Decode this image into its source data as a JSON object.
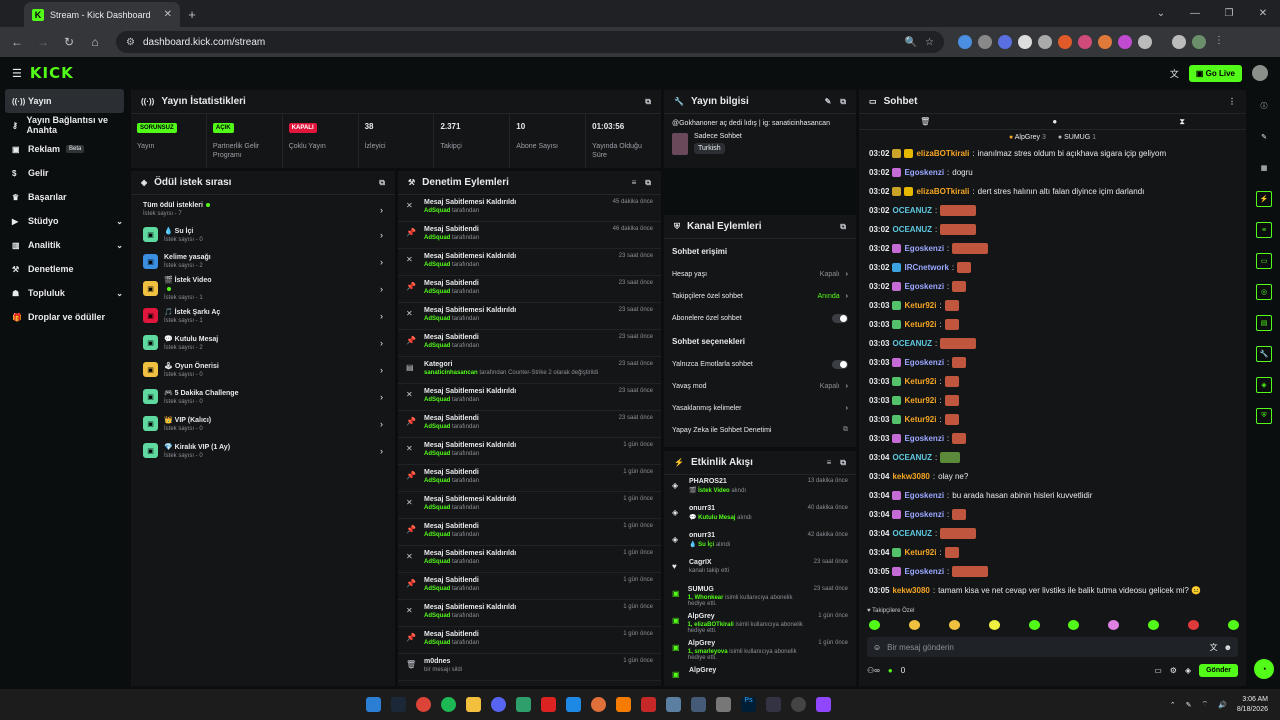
{
  "browser": {
    "tab_title": "Stream - Kick Dashboard",
    "url": "dashboard.kick.com/stream"
  },
  "header": {
    "logo": "KICK",
    "go_live": "Go Live"
  },
  "sidebar": {
    "items": [
      {
        "label": "Yayın",
        "icon": "broadcast-icon"
      },
      {
        "label": "Yayın Bağlantısı ve Anahta",
        "icon": "key-icon"
      },
      {
        "label": "Reklam",
        "icon": "ad-icon",
        "badge": "Beta"
      },
      {
        "label": "Gelir",
        "icon": "money-icon"
      },
      {
        "label": "Başarılar",
        "icon": "trophy-icon"
      },
      {
        "label": "Stüdyo",
        "icon": "studio-icon"
      },
      {
        "label": "Analitik",
        "icon": "chart-icon"
      },
      {
        "label": "Denetleme",
        "icon": "hammer-icon"
      },
      {
        "label": "Topluluk",
        "icon": "community-icon"
      },
      {
        "label": "Droplar ve ödüller",
        "icon": "gift-icon"
      }
    ]
  },
  "stats": {
    "title": "Yayın İstatistikleri",
    "items": [
      {
        "badge": "SORUNSUZ",
        "value": "",
        "label": "Yayın",
        "color": "#53fc18"
      },
      {
        "badge": "AÇIK",
        "value": "",
        "label": "Partnerlik Gelir Programı",
        "color": "#53fc18"
      },
      {
        "badge": "KAPALI",
        "value": "",
        "label": "Çoklu Yayın",
        "color": "#e0163c"
      },
      {
        "badge": "",
        "value": "38",
        "label": "İzleyici"
      },
      {
        "badge": "",
        "value": "2.371",
        "label": "Takipçi"
      },
      {
        "badge": "",
        "value": "10",
        "label": "Abone Sayısı"
      },
      {
        "badge": "",
        "value": "01:03:56",
        "label": "Yayında Olduğu Süre"
      }
    ]
  },
  "info": {
    "title": "Yayın bilgisi",
    "stream_title": "@Gokhanoner aç dedi lıdış | ig: sanaticinhasancan",
    "category": "Sadece Sohbet",
    "tag": "Turkish"
  },
  "queue": {
    "title": "Ödül istek sırası",
    "all_label": "Tüm ödül istekleri",
    "all_count": "İstek sayısı - 7",
    "items": [
      {
        "name": "💧 Su İçi",
        "count": "İstek sayısı - 0"
      },
      {
        "name": "Kelime yasağı",
        "count": "İstek sayısı - 2"
      },
      {
        "name": "🎬 İstek Video",
        "count": "İstek sayısı - 1"
      },
      {
        "name": "🎵 İstek Şarkı Aç",
        "count": "İstek sayısı - 1"
      },
      {
        "name": "💬 Kutulu Mesaj",
        "count": "İstek sayısı - 2"
      },
      {
        "name": "🕹 Oyun Önerisi",
        "count": "İstek sayısı - 0"
      },
      {
        "name": "🎮 5 Dakika Challenge",
        "count": "İstek sayısı - 0"
      },
      {
        "name": "👑 VIP (Kalıcı)",
        "count": "İstek sayısı - 0"
      },
      {
        "name": "💎 Kiralık VIP (1 Ay)",
        "count": "İstek sayısı - 0"
      }
    ]
  },
  "moderation": {
    "title": "Denetim Eylemleri",
    "items": [
      {
        "icon": "unpin-icon",
        "title": "Mesaj Sabitlemesi Kaldırıldı",
        "user": "AdSquad",
        "suffix": "tarafından",
        "time": "45 dakika önce"
      },
      {
        "icon": "pin-icon",
        "title": "Mesaj Sabitlendi",
        "user": "AdSquad",
        "suffix": "tarafından",
        "time": "46 dakika önce"
      },
      {
        "icon": "unpin-icon",
        "title": "Mesaj Sabitlemesi Kaldırıldı",
        "user": "AdSquad",
        "suffix": "tarafından",
        "time": "23 saat önce"
      },
      {
        "icon": "pin-icon",
        "title": "Mesaj Sabitlendi",
        "user": "AdSquad",
        "suffix": "tarafından",
        "time": "23 saat önce"
      },
      {
        "icon": "unpin-icon",
        "title": "Mesaj Sabitlemesi Kaldırıldı",
        "user": "AdSquad",
        "suffix": "tarafından",
        "time": "23 saat önce"
      },
      {
        "icon": "pin-icon",
        "title": "Mesaj Sabitlendi",
        "user": "AdSquad",
        "suffix": "tarafından",
        "time": "23 saat önce"
      },
      {
        "icon": "category-icon",
        "title": "Kategori",
        "user": "sanaticinhasancan",
        "suffix": "tarafından Counter-Strike 2 olarak değiştirildi",
        "time": "23 saat önce"
      },
      {
        "icon": "unpin-icon",
        "title": "Mesaj Sabitlemesi Kaldırıldı",
        "user": "AdSquad",
        "suffix": "tarafından",
        "time": "23 saat önce"
      },
      {
        "icon": "pin-icon",
        "title": "Mesaj Sabitlendi",
        "user": "AdSquad",
        "suffix": "tarafından",
        "time": "23 saat önce"
      },
      {
        "icon": "unpin-icon",
        "title": "Mesaj Sabitlemesi Kaldırıldı",
        "user": "AdSquad",
        "suffix": "tarafından",
        "time": "1 gün önce"
      },
      {
        "icon": "pin-icon",
        "title": "Mesaj Sabitlendi",
        "user": "AdSquad",
        "suffix": "tarafından",
        "time": "1 gün önce"
      },
      {
        "icon": "unpin-icon",
        "title": "Mesaj Sabitlemesi Kaldırıldı",
        "user": "AdSquad",
        "suffix": "tarafından",
        "time": "1 gün önce"
      },
      {
        "icon": "pin-icon",
        "title": "Mesaj Sabitlendi",
        "user": "AdSquad",
        "suffix": "tarafından",
        "time": "1 gün önce"
      },
      {
        "icon": "unpin-icon",
        "title": "Mesaj Sabitlemesi Kaldırıldı",
        "user": "AdSquad",
        "suffix": "tarafından",
        "time": "1 gün önce"
      },
      {
        "icon": "pin-icon",
        "title": "Mesaj Sabitlendi",
        "user": "AdSquad",
        "suffix": "tarafından",
        "time": "1 gün önce"
      },
      {
        "icon": "unpin-icon",
        "title": "Mesaj Sabitlemesi Kaldırıldı",
        "user": "AdSquad",
        "suffix": "tarafından",
        "time": "1 gün önce"
      },
      {
        "icon": "pin-icon",
        "title": "Mesaj Sabitlendi",
        "user": "AdSquad",
        "suffix": "tarafından",
        "time": "1 gün önce"
      },
      {
        "icon": "trash-icon",
        "title": "m0dnes",
        "user": "",
        "suffix": "bir mesajı sildi",
        "time": "1 gün önce"
      }
    ]
  },
  "channel_actions": {
    "title": "Kanal Eylemleri",
    "section1": "Sohbet erişimi",
    "rows1": [
      {
        "label": "Hesap yaşı",
        "value": "Kapalı",
        "kind": "chevron"
      },
      {
        "label": "Takipçilere özel sohbet",
        "value": "Anında",
        "kind": "chevron-green"
      },
      {
        "label": "Abonelere özel sohbet",
        "value": "",
        "kind": "toggle"
      }
    ],
    "section2": "Sohbet seçenekleri",
    "rows2": [
      {
        "label": "Yalnızca Emotlarla sohbet",
        "value": "",
        "kind": "toggle"
      },
      {
        "label": "Yavaş mod",
        "value": "Kapalı",
        "kind": "chevron"
      },
      {
        "label": "Yasaklanmış kelimeler",
        "value": "",
        "kind": "chevron"
      },
      {
        "label": "Yapay Zeka ile Sohbet Denetimi",
        "value": "",
        "kind": "external"
      }
    ]
  },
  "activity": {
    "title": "Etkinlik Akışı",
    "items": [
      {
        "icon": "reward-icon",
        "user": "PHAROS21",
        "detail": "🎬 İstek Video",
        "suffix": "alındı",
        "time": "13 dakika önce"
      },
      {
        "icon": "reward-icon",
        "user": "onurr31",
        "detail": "💬 Kutulu Mesaj",
        "suffix": "alındı",
        "time": "40 dakika önce"
      },
      {
        "icon": "reward-icon",
        "user": "onurr31",
        "detail": "💧 Su İçi",
        "suffix": "alındı",
        "time": "42 dakika önce"
      },
      {
        "icon": "heart-icon",
        "user": "CagrIX",
        "detail": "",
        "suffix": "kanalı takip etti",
        "time": "23 saat önce"
      },
      {
        "icon": "gift-sub-icon",
        "user": "SUMUG",
        "detail": "1, Whonkear",
        "suffix": "isimli kullanıcıya abonelik hediye etti.",
        "time": "23 saat önce"
      },
      {
        "icon": "gift-sub-icon",
        "user": "AlpGrey",
        "detail": "1, elizaBOTkirali",
        "suffix": "isimli kullanıcıya abonelik hediye etti.",
        "time": "1 gün önce"
      },
      {
        "icon": "gift-sub-icon",
        "user": "AlpGrey",
        "detail": "1, smarleyova",
        "suffix": "isimli kullanıcıya abonelik hediye etti.",
        "time": "1 gün önce"
      },
      {
        "icon": "gift-sub-icon",
        "user": "AlpGrey",
        "detail": "",
        "suffix": "",
        "time": ""
      }
    ]
  },
  "chat": {
    "title": "Sohbet",
    "pinned": [
      {
        "name": "AlpGrey",
        "count": "3"
      },
      {
        "name": "SUMUG",
        "count": "1"
      }
    ],
    "messages": [
      {
        "t": "03:02",
        "user": "elizaBOTkirali",
        "color": "#f5a623",
        "text": "inanılmaz stres oldum bi açıkhava sigara içip geliyom",
        "badges": [
          "#c9a227",
          "#e6b800"
        ],
        "emote": ""
      },
      {
        "t": "03:02",
        "user": "Egoskenzi",
        "color": "#9aa8ff",
        "text": "dogru",
        "badges": [
          "#c56bd6"
        ],
        "emote": ""
      },
      {
        "t": "03:02",
        "user": "elizaBOTkirali",
        "color": "#f5a623",
        "text": "dert stres halının altı falan diyince içim darlandı",
        "badges": [
          "#c9a227",
          "#e6b800"
        ],
        "emote": ""
      },
      {
        "t": "03:02",
        "user": "OCEANUZ",
        "color": "#5fc9e0",
        "text": "",
        "badges": [],
        "emote": "wide"
      },
      {
        "t": "03:02",
        "user": "OCEANUZ",
        "color": "#5fc9e0",
        "text": "",
        "badges": [],
        "emote": "wide"
      },
      {
        "t": "03:02",
        "user": "Egoskenzi",
        "color": "#9aa8ff",
        "text": "",
        "badges": [
          "#c56bd6"
        ],
        "emote": "wide"
      },
      {
        "t": "03:02",
        "user": "IRCnetwork",
        "color": "#9aa8ff",
        "text": "",
        "badges": [
          "#3aa3e0"
        ],
        "emote": "small"
      },
      {
        "t": "03:02",
        "user": "Egoskenzi",
        "color": "#9aa8ff",
        "text": "",
        "badges": [
          "#c56bd6"
        ],
        "emote": "small"
      },
      {
        "t": "03:03",
        "user": "Ketur92i",
        "color": "#f5a623",
        "text": "",
        "badges": [
          "#53c26b"
        ],
        "emote": "small"
      },
      {
        "t": "03:03",
        "user": "Ketur92i",
        "color": "#f5a623",
        "text": "",
        "badges": [
          "#53c26b"
        ],
        "emote": "small"
      },
      {
        "t": "03:03",
        "user": "OCEANUZ",
        "color": "#5fc9e0",
        "text": "",
        "badges": [],
        "emote": "wide"
      },
      {
        "t": "03:03",
        "user": "Egoskenzi",
        "color": "#9aa8ff",
        "text": "",
        "badges": [
          "#c56bd6"
        ],
        "emote": "small"
      },
      {
        "t": "03:03",
        "user": "Ketur92i",
        "color": "#f5a623",
        "text": "",
        "badges": [
          "#53c26b"
        ],
        "emote": "small"
      },
      {
        "t": "03:03",
        "user": "Ketur92i",
        "color": "#f5a623",
        "text": "",
        "badges": [
          "#53c26b"
        ],
        "emote": "small"
      },
      {
        "t": "03:03",
        "user": "Ketur92i",
        "color": "#f5a623",
        "text": "",
        "badges": [
          "#53c26b"
        ],
        "emote": "small"
      },
      {
        "t": "03:03",
        "user": "Egoskenzi",
        "color": "#9aa8ff",
        "text": "",
        "badges": [
          "#c56bd6"
        ],
        "emote": "small"
      },
      {
        "t": "03:04",
        "user": "OCEANUZ",
        "color": "#5fc9e0",
        "text": "",
        "badges": [],
        "emote": "green"
      },
      {
        "t": "03:04",
        "user": "kekw3080",
        "color": "#f5a623",
        "text": "olay ne?",
        "badges": [],
        "emote": ""
      },
      {
        "t": "03:04",
        "user": "Egoskenzi",
        "color": "#9aa8ff",
        "text": "bu arada hasan abinin hisleri kuvvetlidir",
        "badges": [
          "#c56bd6"
        ],
        "emote": ""
      },
      {
        "t": "03:04",
        "user": "Egoskenzi",
        "color": "#9aa8ff",
        "text": "",
        "badges": [
          "#c56bd6"
        ],
        "emote": "small"
      },
      {
        "t": "03:04",
        "user": "OCEANUZ",
        "color": "#5fc9e0",
        "text": "",
        "badges": [],
        "emote": "wide"
      },
      {
        "t": "03:04",
        "user": "Ketur92i",
        "color": "#f5a623",
        "text": "",
        "badges": [
          "#53c26b"
        ],
        "emote": "small"
      },
      {
        "t": "03:05",
        "user": "Egoskenzi",
        "color": "#9aa8ff",
        "text": "",
        "badges": [
          "#c56bd6"
        ],
        "emote": "wide"
      },
      {
        "t": "03:05",
        "user": "kekw3080",
        "color": "#f5a623",
        "text": "tamam kisa ve net cevap ver livstiks ile balik tutma videosu gelicek mi? 😐",
        "badges": [],
        "emote": ""
      }
    ],
    "followers_only": "Takipçilere Özel",
    "input_placeholder": "Bir mesaj gönderin",
    "points": "0",
    "send": "Gönder"
  },
  "taskbar": {
    "time": "3:06 AM",
    "date": "8/18/2026"
  }
}
